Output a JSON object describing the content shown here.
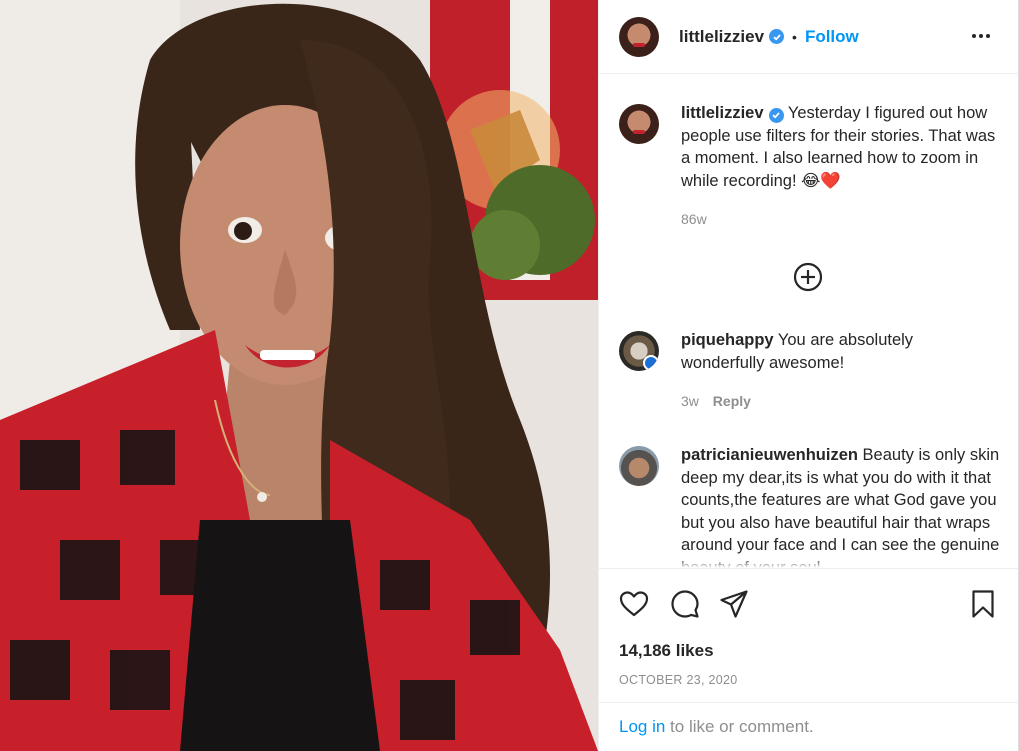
{
  "post": {
    "username": "littlelizziev",
    "follow_label": "Follow",
    "separator": "•",
    "caption": "Yesterday I figured out how people use filters for their stories. That was a moment. I also learned how to zoom in while recording! 😂❤️",
    "age": "86w"
  },
  "comments": [
    {
      "username": "piquehappy",
      "text": "You are absolutely wonderfully awesome!",
      "age": "3w",
      "reply_label": "Reply"
    },
    {
      "username": "patricianieuwenhuizen",
      "text": "Beauty is only skin deep my dear,its is what you do with it that counts,the features are what God gave you but you also have beautiful hair that wraps around your face and I can see the genuine beauty of your soul.",
      "age": "",
      "reply_label": ""
    }
  ],
  "actions": {
    "likes": "14,186 likes",
    "date": "OCTOBER 23, 2020",
    "login_link": "Log in",
    "login_suffix": " to like or comment."
  },
  "icons": [
    "more-icon",
    "verified-icon",
    "add-comment-icon",
    "like-icon",
    "comment-icon",
    "share-icon",
    "save-icon"
  ],
  "colors": {
    "accent": "#0095f6",
    "verified": "#3897f0",
    "muted": "#8e8e8e",
    "text": "#262626"
  }
}
